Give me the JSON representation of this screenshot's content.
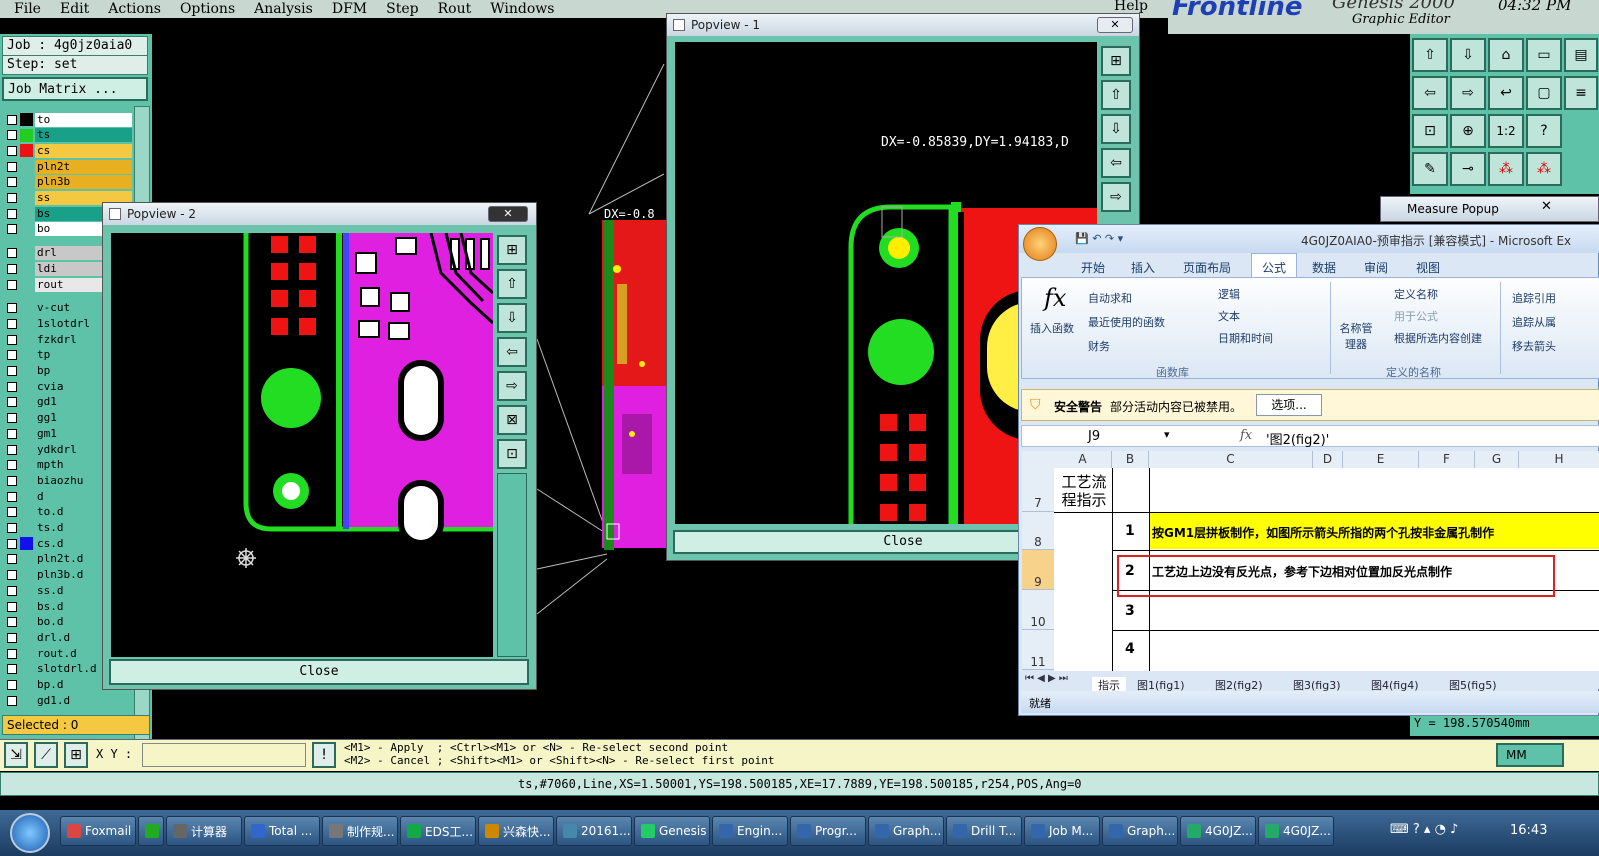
{
  "menubar": {
    "items": [
      "File",
      "Edit",
      "Actions",
      "Options",
      "Analysis",
      "DFM",
      "Step",
      "Rout",
      "Windows"
    ],
    "help": "Help"
  },
  "brand": {
    "logo": "Frontline",
    "product": "Genesis 2000",
    "subtitle": "Graphic Editor",
    "time": "04:32 PM"
  },
  "left": {
    "job": "Job : 4g0jz0aia0",
    "step": "Step: set",
    "job_matrix": "Job Matrix ...",
    "selected": "Selected : 0",
    "layers": [
      {
        "name": "to",
        "swatch": "#000000",
        "bg": "#ffffff"
      },
      {
        "name": "ts",
        "swatch": "#22cc22",
        "bg": "#19a088"
      },
      {
        "name": "cs",
        "swatch": "#ee1111",
        "bg": "#f5c842"
      },
      {
        "name": "pln2t",
        "swatch": "",
        "bg": "#e8b020"
      },
      {
        "name": "pln3b",
        "swatch": "",
        "bg": "#e8b020"
      },
      {
        "name": "ss",
        "swatch": "",
        "bg": "#f5c842"
      },
      {
        "name": "bs",
        "swatch": "",
        "bg": "#19a088"
      },
      {
        "name": "bo",
        "swatch": "",
        "bg": "#ffffff"
      },
      {
        "name": "drl",
        "swatch": "",
        "bg": "#c8c8c8"
      },
      {
        "name": "ldi",
        "swatch": "",
        "bg": "#c8c8c8"
      },
      {
        "name": "rout",
        "swatch": "",
        "bg": "#e8e8e8"
      },
      {
        "name": "v-cut",
        "swatch": "",
        "bg": "#5ec2a8"
      },
      {
        "name": "1slotdrl",
        "swatch": "",
        "bg": "#5ec2a8"
      },
      {
        "name": "fzkdrl",
        "swatch": "",
        "bg": "#5ec2a8"
      },
      {
        "name": "tp",
        "swatch": "",
        "bg": "#5ec2a8"
      },
      {
        "name": "bp",
        "swatch": "",
        "bg": "#5ec2a8"
      },
      {
        "name": "cvia",
        "swatch": "",
        "bg": "#5ec2a8"
      },
      {
        "name": "gd1",
        "swatch": "",
        "bg": "#5ec2a8"
      },
      {
        "name": "gg1",
        "swatch": "",
        "bg": "#5ec2a8"
      },
      {
        "name": "gm1",
        "swatch": "",
        "bg": "#5ec2a8"
      },
      {
        "name": "ydkdrl",
        "swatch": "",
        "bg": "#5ec2a8"
      },
      {
        "name": "mpth",
        "swatch": "",
        "bg": "#5ec2a8"
      },
      {
        "name": "biaozhu",
        "swatch": "",
        "bg": "#5ec2a8"
      },
      {
        "name": "d",
        "swatch": "",
        "bg": "#5ec2a8"
      },
      {
        "name": "to.d",
        "swatch": "",
        "bg": "#5ec2a8"
      },
      {
        "name": "ts.d",
        "swatch": "",
        "bg": "#5ec2a8"
      },
      {
        "name": "cs.d",
        "swatch": "#1111ee",
        "bg": "#5ec2a8"
      },
      {
        "name": "pln2t.d",
        "swatch": "",
        "bg": "#5ec2a8"
      },
      {
        "name": "pln3b.d",
        "swatch": "",
        "bg": "#5ec2a8"
      },
      {
        "name": "ss.d",
        "swatch": "",
        "bg": "#5ec2a8"
      },
      {
        "name": "bs.d",
        "swatch": "",
        "bg": "#5ec2a8"
      },
      {
        "name": "bo.d",
        "swatch": "",
        "bg": "#5ec2a8"
      },
      {
        "name": "drl.d",
        "swatch": "",
        "bg": "#5ec2a8"
      },
      {
        "name": "rout.d",
        "swatch": "",
        "bg": "#5ec2a8"
      },
      {
        "name": "slotdrl.d",
        "swatch": "",
        "bg": "#5ec2a8"
      },
      {
        "name": "bp.d",
        "swatch": "",
        "bg": "#5ec2a8"
      },
      {
        "name": "gd1.d",
        "swatch": "",
        "bg": "#5ec2a8"
      }
    ]
  },
  "popview1": {
    "title": "Popview - 1",
    "measure": "DX=-0.85839,DY=1.94183,D",
    "close": "Close"
  },
  "popview2": {
    "title": "Popview - 2",
    "close": "Close"
  },
  "canvas": {
    "dx_label": "DX=-0.8"
  },
  "measure": {
    "title": "Measure Popup",
    "y_value": "Y = 198.570540mm"
  },
  "excel": {
    "title": "4G0JZ0AIA0-预审指示 [兼容模式] - Microsoft Ex",
    "tabs": [
      "开始",
      "插入",
      "页面布局",
      "公式",
      "数据",
      "审阅",
      "视图"
    ],
    "active_tab": "公式",
    "insert_func": "插入函数",
    "lib": [
      "自动求和",
      "最近使用的函数",
      "财务",
      "逻辑",
      "文本",
      "日期和时间"
    ],
    "lib_group": "函数库",
    "names": [
      "定义名称",
      "用于公式",
      "根据所选内容创建"
    ],
    "name_mgr": "名称管理器",
    "names_group": "定义的名称",
    "audit": [
      "追踪引用",
      "追踪从属",
      "移去箭头"
    ],
    "security_title": "安全警告",
    "security_msg": "部分活动内容已被禁用。",
    "options_btn": "选项...",
    "cell_ref": "J9",
    "formula": "'图2(fig2)'",
    "columns": [
      "A",
      "B",
      "C",
      "D",
      "E",
      "F",
      "G",
      "H"
    ],
    "rows": [
      {
        "num": "7",
        "a": "工艺流程指示",
        "b": "",
        "c": ""
      },
      {
        "num": "8",
        "a": "",
        "b": "1",
        "c": "按GM1层拼板制作，如图所示箭头所指的两个孔按非金属孔制作"
      },
      {
        "num": "9",
        "a": "",
        "b": "2",
        "c": "工艺边上边没有反光点，参考下边相对位置加反光点制作"
      },
      {
        "num": "10",
        "a": "",
        "b": "3",
        "c": ""
      },
      {
        "num": "11",
        "a": "",
        "b": "4",
        "c": ""
      }
    ],
    "sheets": [
      "指示",
      "图1(fig1)",
      "图2(fig2)",
      "图3(fig3)",
      "图4(fig4)",
      "图5(fig5)"
    ],
    "status": "就绪"
  },
  "bottom": {
    "xy_label": "X Y :",
    "hint1": "<M1> - Apply  ; <Ctrl><M1> or <N> - Re-select second point",
    "hint2": "<M2> - Cancel ; <Shift><M1> or <Shift><N> - Re-select first point",
    "units": "MM",
    "status": "ts,#7060,Line,XS=1.50001,YS=198.500185,XE=17.7889,YE=198.500185,r254,POS,Ang=0"
  },
  "taskbar": {
    "items": [
      "Foxmail",
      "",
      "计算器",
      "Total ...",
      "制作规...",
      "EDS工...",
      "兴森快...",
      "20161...",
      "Genesis",
      "Engin...",
      "Progr...",
      "Graph...",
      "Drill T...",
      "Job M...",
      "Graph...",
      "4G0JZ...",
      "4G0JZ..."
    ],
    "time": "16:43"
  }
}
